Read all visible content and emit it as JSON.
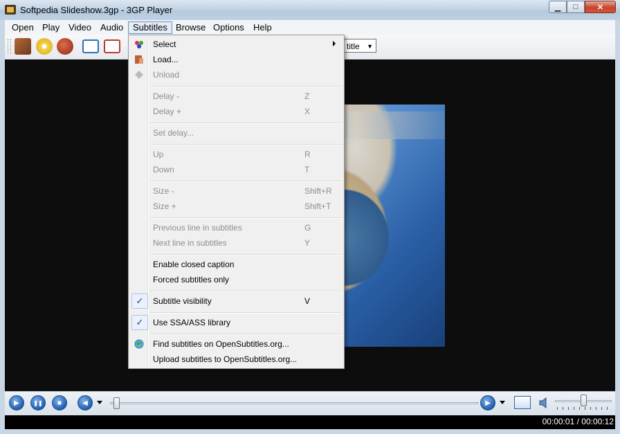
{
  "window": {
    "title": "Softpedia Slideshow.3gp - 3GP Player",
    "min_glyph": "▁",
    "max_glyph": "□",
    "close_glyph": "✕"
  },
  "menubar": {
    "items": [
      "Open",
      "Play",
      "Video",
      "Audio",
      "Subtitles",
      "Browse",
      "Options",
      "Help"
    ],
    "active": "Subtitles"
  },
  "toolbar": {
    "subtitle_combo_value": "title",
    "combo_arrow": "▼"
  },
  "subtitles_menu": {
    "items": [
      {
        "label": "Select",
        "shortcut": "",
        "enabled": true,
        "submenu": true,
        "icon": "select-subtitle-icon"
      },
      {
        "label": "Load...",
        "shortcut": "",
        "enabled": true,
        "icon": "load-subtitle-icon"
      },
      {
        "label": "Unload",
        "shortcut": "",
        "enabled": false,
        "icon": "unload-subtitle-icon"
      },
      {
        "label": "Delay -",
        "shortcut": "Z",
        "enabled": false
      },
      {
        "label": "Delay +",
        "shortcut": "X",
        "enabled": false
      },
      {
        "label": "Set delay...",
        "shortcut": "",
        "enabled": false
      },
      {
        "label": "Up",
        "shortcut": "R",
        "enabled": false
      },
      {
        "label": "Down",
        "shortcut": "T",
        "enabled": false
      },
      {
        "label": "Size -",
        "shortcut": "Shift+R",
        "enabled": false
      },
      {
        "label": "Size +",
        "shortcut": "Shift+T",
        "enabled": false
      },
      {
        "label": "Previous line in subtitles",
        "shortcut": "G",
        "enabled": false
      },
      {
        "label": "Next line in subtitles",
        "shortcut": "Y",
        "enabled": false
      },
      {
        "label": "Enable closed caption",
        "shortcut": "",
        "enabled": true
      },
      {
        "label": "Forced subtitles only",
        "shortcut": "",
        "enabled": true
      },
      {
        "label": "Subtitle visibility",
        "shortcut": "V",
        "enabled": true,
        "checked": true,
        "check_glyph": "✓"
      },
      {
        "label": "Use SSA/ASS library",
        "shortcut": "",
        "enabled": true,
        "checked": true,
        "check_glyph": "✓"
      },
      {
        "label": "Find subtitles on OpenSubtitles.org...",
        "shortcut": "",
        "enabled": true,
        "icon": "globe-icon"
      },
      {
        "label": "Upload subtitles to OpenSubtitles.org...",
        "shortcut": "",
        "enabled": true
      }
    ]
  },
  "controls": {
    "play_glyph": "▶",
    "pause_glyph": "❚❚",
    "stop_glyph": "■",
    "rewind_glyph": "◀",
    "forward_glyph": "▶",
    "seek_position": 0.01,
    "volume_level": 0.5
  },
  "status": {
    "time": "00:00:01 / 00:00:12"
  }
}
